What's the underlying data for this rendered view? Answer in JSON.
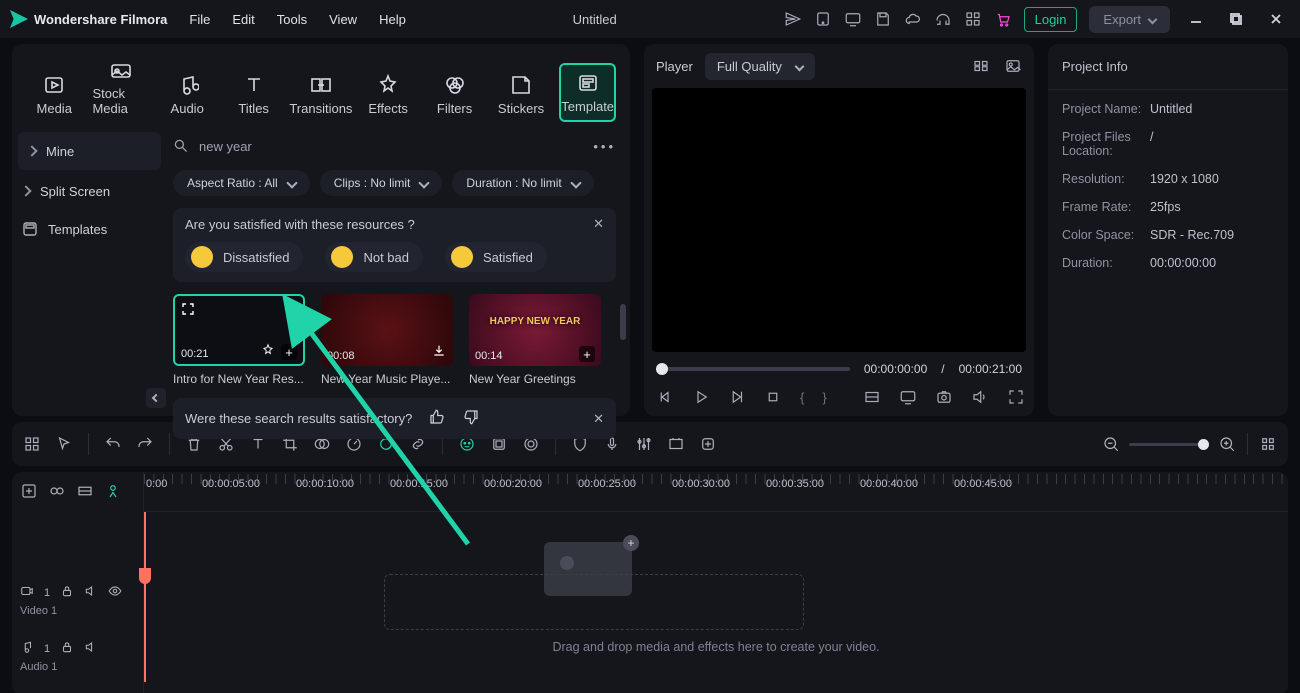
{
  "titlebar": {
    "brand": "Wondershare Filmora",
    "menus": [
      "File",
      "Edit",
      "Tools",
      "View",
      "Help"
    ],
    "title": "Untitled",
    "login": "Login",
    "export": "Export"
  },
  "tabs": [
    "Media",
    "Stock Media",
    "Audio",
    "Titles",
    "Transitions",
    "Effects",
    "Filters",
    "Stickers",
    "Template"
  ],
  "tabs_active": "Template",
  "sidebar": {
    "items": [
      {
        "label": "Mine",
        "hasChevron": true
      },
      {
        "label": "Split Screen",
        "hasChevron": true
      },
      {
        "label": "Templates",
        "hasChevron": false
      }
    ],
    "selected": "Mine"
  },
  "search": {
    "query": "new year"
  },
  "filters": {
    "aspect": "Aspect Ratio : All",
    "clips": "Clips : No limit",
    "duration": "Duration : No limit"
  },
  "feedback": {
    "question": "Are you satisfied with these resources ?",
    "options": [
      "Dissatisfied",
      "Not bad",
      "Satisfied"
    ]
  },
  "templates": [
    {
      "name": "Intro for New Year Res...",
      "duration": "00:21",
      "selected": true
    },
    {
      "name": "New Year Music Playe...",
      "duration": "00:08",
      "selected": false
    },
    {
      "name": "New Year Greetings",
      "duration": "00:14",
      "selected": false,
      "banner": "HAPPY\nNEW YEAR"
    }
  ],
  "feedback2": "Were these search results satisfactory?",
  "player": {
    "label": "Player",
    "quality": "Full Quality",
    "cur": "00:00:00:00",
    "sep": "/",
    "total": "00:00:21:00"
  },
  "info": {
    "title": "Project Info",
    "rows": [
      {
        "k": "Project Name:",
        "v": "Untitled"
      },
      {
        "k": "Project Files Location:",
        "v": "/"
      },
      {
        "k": "Resolution:",
        "v": "1920 x 1080"
      },
      {
        "k": "Frame Rate:",
        "v": "25fps"
      },
      {
        "k": "Color Space:",
        "v": "SDR - Rec.709"
      },
      {
        "k": "Duration:",
        "v": "00:00:00:00"
      }
    ]
  },
  "timeline": {
    "ruler_start": "0:00",
    "marks": [
      "00:00:05:00",
      "00:00:10:00",
      "00:00:15:00",
      "00:00:20:00",
      "00:00:25:00",
      "00:00:30:00",
      "00:00:35:00",
      "00:00:40:00",
      "00:00:45:00"
    ],
    "video_label": "Video 1",
    "audio_label": "Audio 1",
    "drop_text": "Drag and drop media and effects here to create your video."
  }
}
